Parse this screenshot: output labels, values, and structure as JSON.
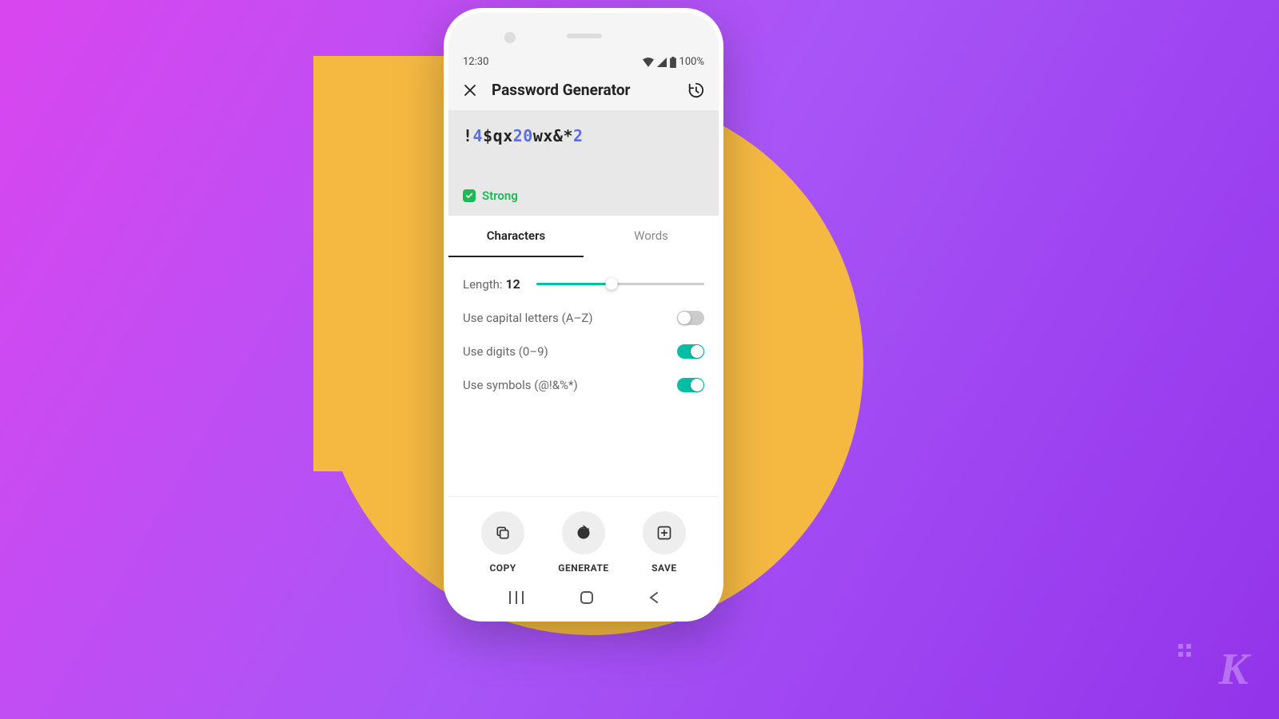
{
  "status": {
    "time": "12:30",
    "battery": "100%"
  },
  "header": {
    "title": "Password Generator"
  },
  "password": {
    "segments": [
      {
        "t": "!",
        "c": "sym"
      },
      {
        "t": "4",
        "c": "digit"
      },
      {
        "t": "$",
        "c": "sym"
      },
      {
        "t": "q",
        "c": "letter"
      },
      {
        "t": "x",
        "c": "letter"
      },
      {
        "t": "2",
        "c": "digit"
      },
      {
        "t": "0",
        "c": "digit"
      },
      {
        "t": "w",
        "c": "letter"
      },
      {
        "t": "x",
        "c": "letter"
      },
      {
        "t": "&",
        "c": "sym"
      },
      {
        "t": "*",
        "c": "sym"
      },
      {
        "t": "2",
        "c": "digit"
      }
    ],
    "strength": "Strong"
  },
  "tabs": [
    {
      "label": "Characters",
      "active": true
    },
    {
      "label": "Words",
      "active": false
    }
  ],
  "settings": {
    "length_label": "Length:",
    "length_value": "12",
    "options": [
      {
        "label": "Use capital letters (A–Z)",
        "on": false
      },
      {
        "label": "Use digits (0–9)",
        "on": true
      },
      {
        "label": "Use symbols (@!&%*)",
        "on": true
      }
    ]
  },
  "actions": {
    "copy": "COPY",
    "generate": "GENERATE",
    "save": "SAVE"
  },
  "watermark": "K"
}
